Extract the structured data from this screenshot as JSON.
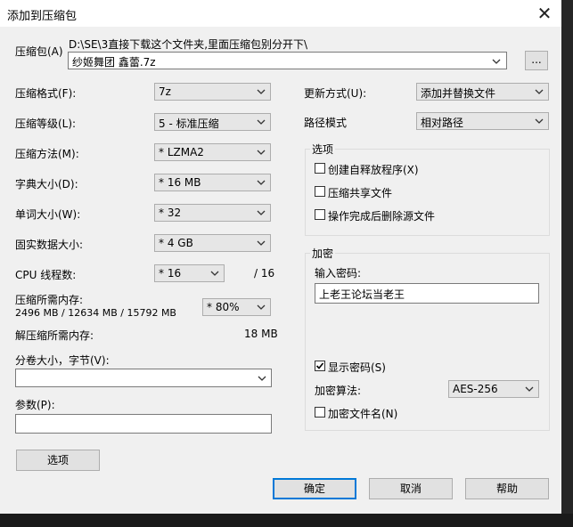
{
  "dialog": {
    "title": "添加到压缩包",
    "close_glyph": "✕"
  },
  "archive": {
    "label": "压缩包(A)",
    "path": "D:\\SE\\3直接下载这个文件夹,里面压缩包别分开下\\",
    "name": "纱姬舞团 鑫蕾.7z",
    "browse_label": "..."
  },
  "left": {
    "format_label": "压缩格式(F):",
    "format_value": "7z",
    "level_label": "压缩等级(L):",
    "level_value": "5 - 标准压缩",
    "method_label": "压缩方法(M):",
    "method_value": "* LZMA2",
    "dict_label": "字典大小(D):",
    "dict_value": "* 16 MB",
    "word_label": "单词大小(W):",
    "word_value": "* 32",
    "solid_label": "固实数据大小:",
    "solid_value": "* 4 GB",
    "threads_label": "CPU 线程数:",
    "threads_value": "* 16",
    "threads_total": "/ 16",
    "mem_label": "压缩所需内存:",
    "mem_detail": "2496 MB / 12634 MB / 15792 MB",
    "mem_value": "* 80%",
    "decomp_label": "解压缩所需内存:",
    "decomp_value": "18 MB",
    "split_label": "分卷大小，字节(V):",
    "split_value": "",
    "params_label": "参数(P):",
    "params_value": "",
    "options_button": "选项"
  },
  "right": {
    "update_label": "更新方式(U):",
    "update_value": "添加并替换文件",
    "pathmode_label": "路径模式",
    "pathmode_value": "相对路径",
    "options_group": "选项",
    "opt_sfx": "创建自释放程序(X)",
    "opt_shared": "压缩共享文件",
    "opt_delete": "操作完成后删除源文件",
    "enc_group": "加密",
    "password_label": "输入密码:",
    "password_value": "上老王论坛当老王",
    "show_password": "显示密码(S)",
    "method_label": "加密算法:",
    "method_value": "AES-256",
    "encrypt_names": "加密文件名(N)"
  },
  "checks": {
    "sfx": false,
    "shared": false,
    "delete": false,
    "show_password": true,
    "encrypt_names": false
  },
  "buttons": {
    "ok": "确定",
    "cancel": "取消",
    "help": "帮助"
  },
  "colors": {
    "focus_border": "#0078d7",
    "dialog_bg": "#f0f0f0"
  }
}
